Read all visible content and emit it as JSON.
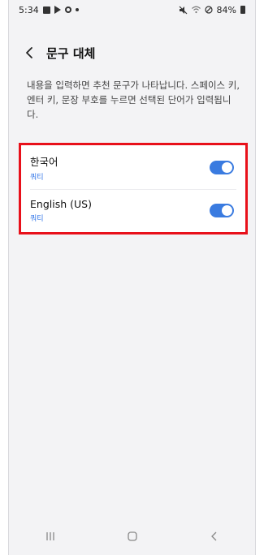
{
  "status_bar": {
    "time": "5:34",
    "battery": "84%"
  },
  "header": {
    "title": "문구 대체"
  },
  "description": "내용을 입력하면 추천 문구가 나타납니다. 스페이스 키, 엔터 키, 문장 부호를 누르면 선택된 단어가 입력됩니다.",
  "languages": [
    {
      "name": "한국어",
      "layout": "쿼티",
      "enabled": true
    },
    {
      "name": "English (US)",
      "layout": "쿼티",
      "enabled": true
    }
  ],
  "colors": {
    "accent": "#3a7be0",
    "highlight": "#e8101a",
    "background": "#f3f3f5"
  },
  "icons": {
    "back": "chevron-left-icon",
    "nav_recent": "recent-apps-icon",
    "nav_home": "home-icon",
    "nav_back": "nav-back-icon"
  }
}
